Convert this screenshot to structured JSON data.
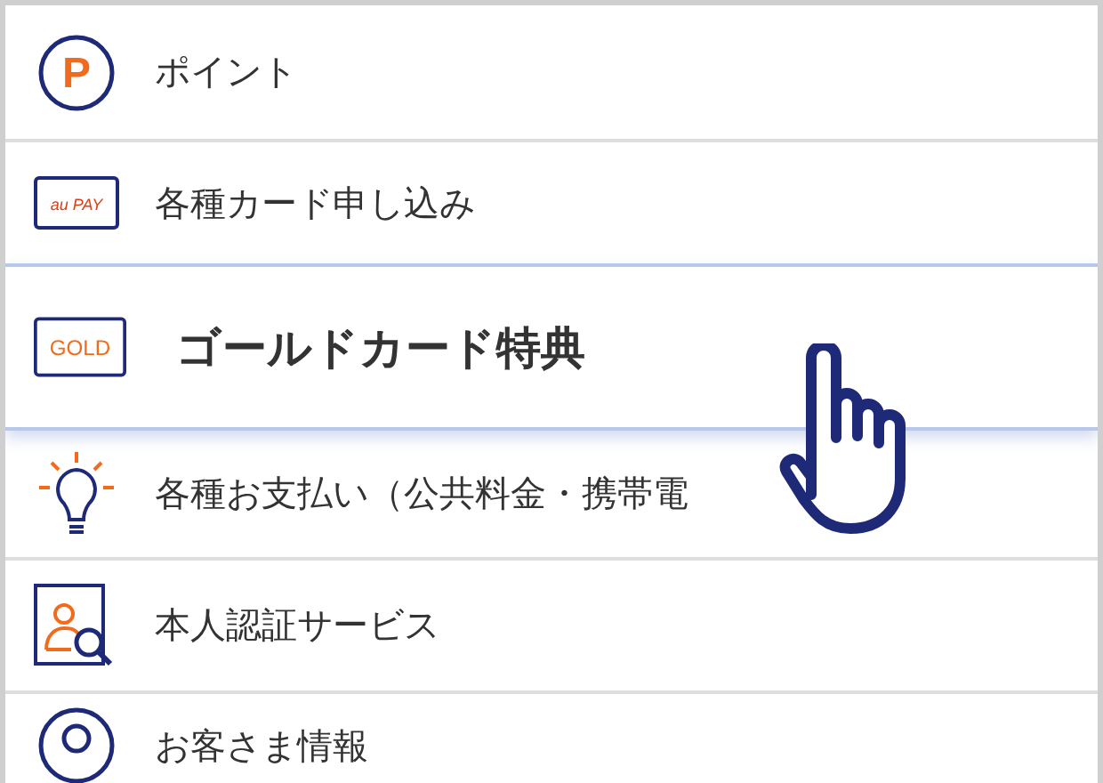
{
  "menu": [
    {
      "kind": "points",
      "label": "ポイント",
      "icon_text": "P",
      "selected": false
    },
    {
      "kind": "aupay",
      "label": "各種カード申し込み",
      "icon_text": "au PAY",
      "selected": false
    },
    {
      "kind": "gold",
      "label": "ゴールドカード特典",
      "icon_text": "GOLD",
      "selected": true
    },
    {
      "kind": "bulb",
      "label": "各種お支払い（公共料金・携帯電",
      "selected": false
    },
    {
      "kind": "identity",
      "label": "本人認証サービス",
      "selected": false
    },
    {
      "kind": "person",
      "label": "お客さま情報",
      "selected": false
    }
  ]
}
